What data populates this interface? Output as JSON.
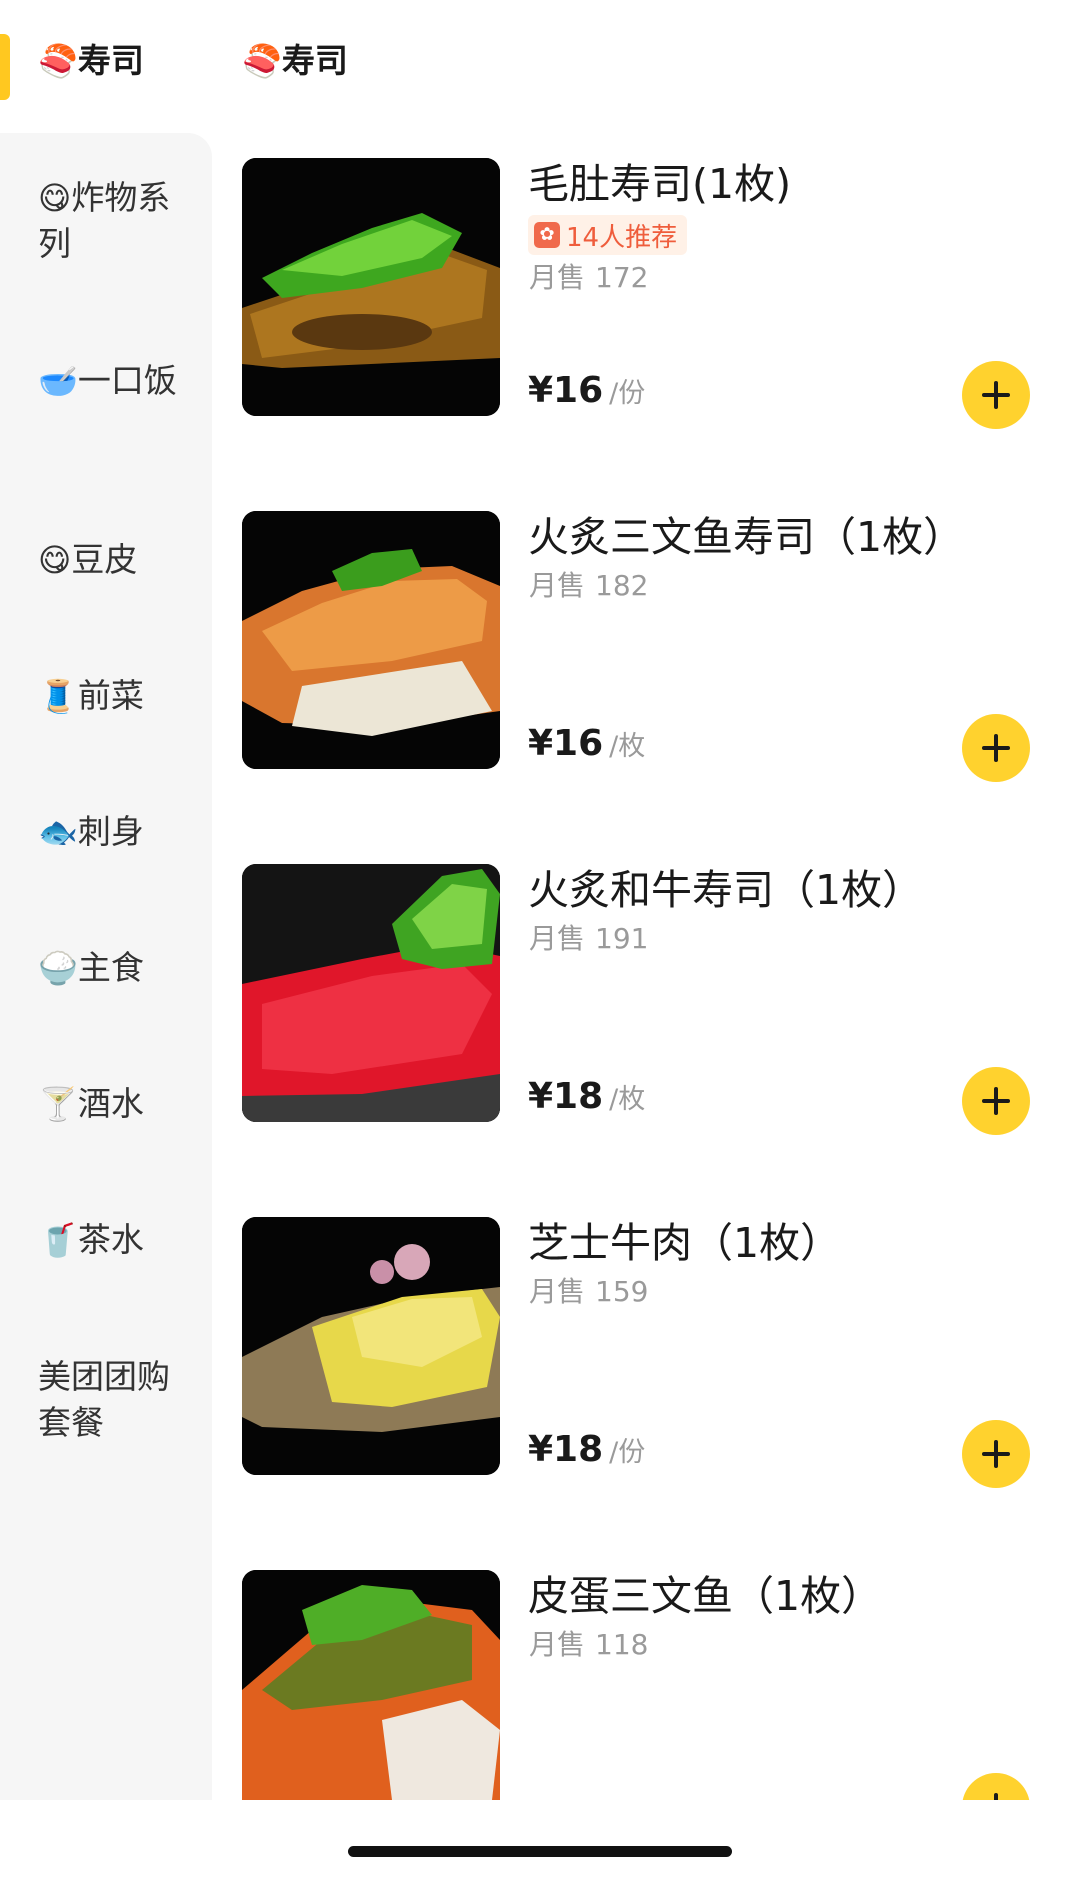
{
  "sidebar": {
    "items": [
      {
        "emoji": "🍣",
        "label": "寿司",
        "active": true
      },
      {
        "emoji": "😋",
        "label": "炸物系列"
      },
      {
        "emoji": "🥣",
        "label": "一口饭"
      },
      {
        "emoji": "😋",
        "label": "豆皮"
      },
      {
        "emoji": "🧵",
        "label": "前菜"
      },
      {
        "emoji": "🐟",
        "label": "刺身"
      },
      {
        "emoji": "🍚",
        "label": "主食"
      },
      {
        "emoji": "🍸",
        "label": "酒水"
      },
      {
        "emoji": "🥤",
        "label": "茶水"
      },
      {
        "emoji": "",
        "label": "美团团购套餐"
      }
    ]
  },
  "section": {
    "emoji": "🍣",
    "title": "寿司"
  },
  "products": [
    {
      "name": "毛肚寿司(1枚)",
      "badge": "14人推荐",
      "sales_label": "月售",
      "sales": "172",
      "price": "¥16",
      "unit": "/份"
    },
    {
      "name": "火炙三文鱼寿司（1枚）",
      "sales_label": "月售",
      "sales": "182",
      "price": "¥16",
      "unit": "/枚"
    },
    {
      "name": "火炙和牛寿司（1枚）",
      "sales_label": "月售",
      "sales": "191",
      "price": "¥18",
      "unit": "/枚"
    },
    {
      "name": "芝士牛肉（1枚）",
      "sales_label": "月售",
      "sales": "159",
      "price": "¥18",
      "unit": "/份"
    },
    {
      "name": "皮蛋三文鱼（1枚）",
      "sales_label": "月售",
      "sales": "118",
      "price": "",
      "unit": ""
    }
  ],
  "colors": {
    "accent": "#ffd22e",
    "sidebar_bg": "#f6f6f6",
    "badge_text": "#ef5d3c"
  },
  "icons": {
    "add": "plus-icon",
    "badge": "recommend-icon"
  }
}
